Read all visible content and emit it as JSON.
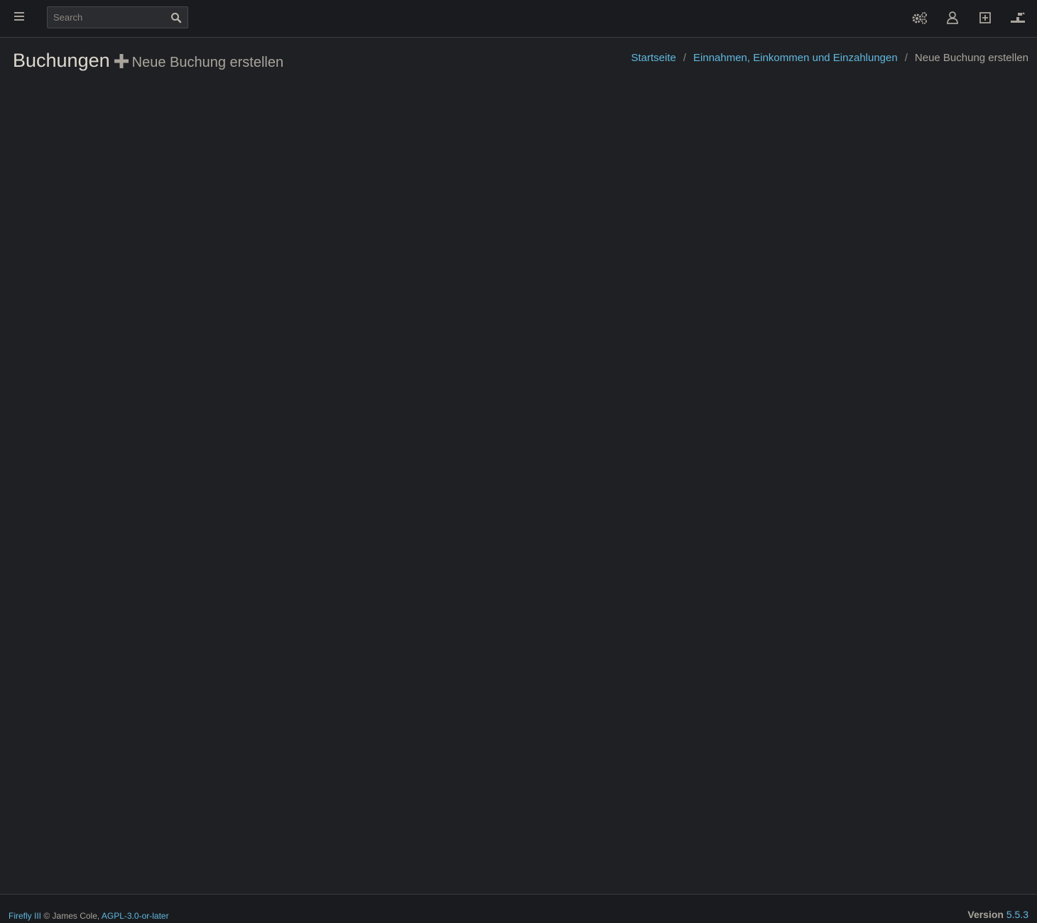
{
  "navbar": {
    "search_placeholder": "Search",
    "icons": [
      "hamburger-menu-icon",
      "search-icon",
      "cogs-icon",
      "user-icon",
      "plus-square-icon",
      "logout-icon"
    ]
  },
  "header": {
    "title": "Buchungen",
    "subtitle": "Neue Buchung erstellen"
  },
  "breadcrumb": {
    "items": [
      {
        "label": "Startseite"
      },
      {
        "label": "Einnahmen, Einkommen und Einzahlungen"
      },
      {
        "label": "Neue Buchung erstellen"
      }
    ],
    "separator": "/"
  },
  "footer": {
    "app_name": "Firefly III",
    "copyright": "© James Cole,",
    "license": "AGPL-3.0-or-later",
    "version_label": "Version",
    "version_number": "5.5.3"
  },
  "colors": {
    "background": "#1f2023",
    "navbar": "#1a1b1e",
    "link": "#5fb8e0",
    "text": "#c9c4bb"
  }
}
